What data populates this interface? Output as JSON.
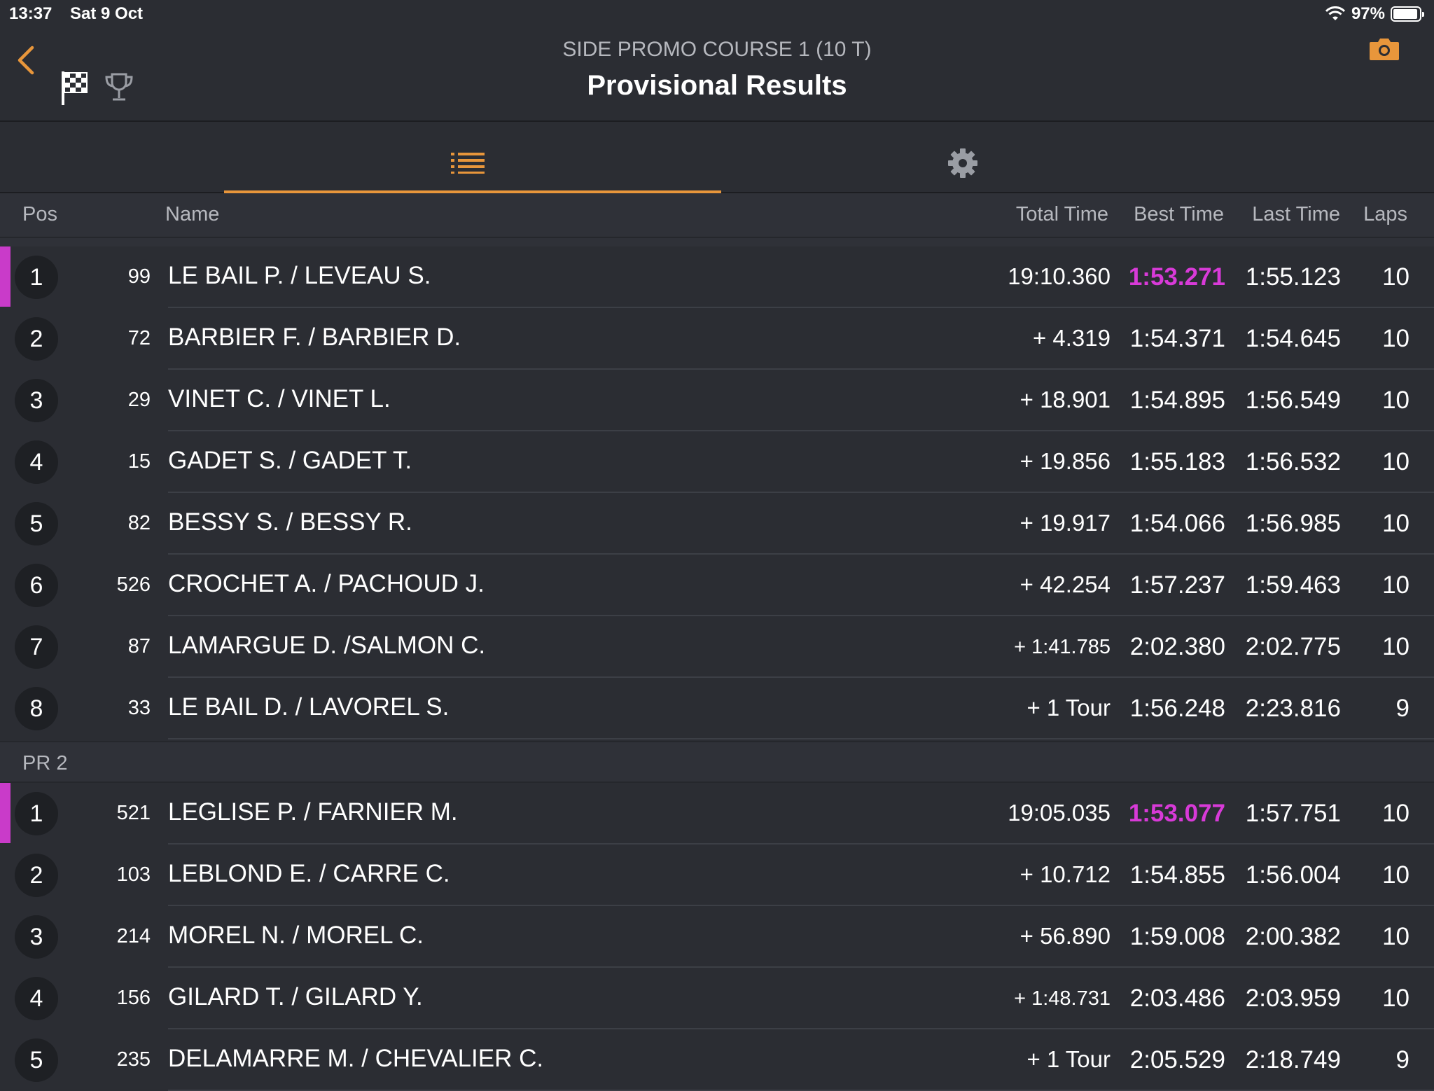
{
  "status": {
    "time": "13:37",
    "date": "Sat 9 Oct",
    "battery": "97%"
  },
  "header": {
    "subtitle": "SIDE PROMO COURSE 1  (10 T)",
    "title": "Provisional Results"
  },
  "columns": {
    "pos": "Pos",
    "name": "Name",
    "total": "Total Time",
    "best": "Best Time",
    "last": "Last Time",
    "laps": "Laps"
  },
  "colors": {
    "accent": "#e8963b",
    "fastest": "#d83ad8",
    "background": "#2b2d33"
  },
  "group1": [
    {
      "pos": "1",
      "num": "99",
      "name": "LE BAIL P. / LEVEAU S.",
      "total": "19:10.360",
      "best": "1:53.271",
      "last": "1:55.123",
      "laps": "10"
    },
    {
      "pos": "2",
      "num": "72",
      "name": "BARBIER F. / BARBIER D.",
      "total": "+ 4.319",
      "best": "1:54.371",
      "last": "1:54.645",
      "laps": "10"
    },
    {
      "pos": "3",
      "num": "29",
      "name": "VINET C. / VINET L.",
      "total": "+ 18.901",
      "best": "1:54.895",
      "last": "1:56.549",
      "laps": "10"
    },
    {
      "pos": "4",
      "num": "15",
      "name": "GADET S. / GADET T.",
      "total": "+ 19.856",
      "best": "1:55.183",
      "last": "1:56.532",
      "laps": "10"
    },
    {
      "pos": "5",
      "num": "82",
      "name": "BESSY S. / BESSY R.",
      "total": "+ 19.917",
      "best": "1:54.066",
      "last": "1:56.985",
      "laps": "10"
    },
    {
      "pos": "6",
      "num": "526",
      "name": "CROCHET A. / PACHOUD J.",
      "total": "+ 42.254",
      "best": "1:57.237",
      "last": "1:59.463",
      "laps": "10"
    },
    {
      "pos": "7",
      "num": "87",
      "name": "LAMARGUE D. /SALMON C.",
      "total": "+ 1:41.785",
      "best": "2:02.380",
      "last": "2:02.775",
      "laps": "10"
    },
    {
      "pos": "8",
      "num": "33",
      "name": "LE BAIL D. / LAVOREL S.",
      "total": "+ 1 Tour",
      "best": "1:56.248",
      "last": "2:23.816",
      "laps": "9"
    }
  ],
  "section2": {
    "label": "PR 2"
  },
  "group2": [
    {
      "pos": "1",
      "num": "521",
      "name": "LEGLISE P. / FARNIER M.",
      "total": "19:05.035",
      "best": "1:53.077",
      "last": "1:57.751",
      "laps": "10"
    },
    {
      "pos": "2",
      "num": "103",
      "name": "LEBLOND E. / CARRE C.",
      "total": "+ 10.712",
      "best": "1:54.855",
      "last": "1:56.004",
      "laps": "10"
    },
    {
      "pos": "3",
      "num": "214",
      "name": "MOREL N. / MOREL C.",
      "total": "+ 56.890",
      "best": "1:59.008",
      "last": "2:00.382",
      "laps": "10"
    },
    {
      "pos": "4",
      "num": "156",
      "name": "GILARD T. / GILARD Y.",
      "total": "+ 1:48.731",
      "best": "2:03.486",
      "last": "2:03.959",
      "laps": "10"
    },
    {
      "pos": "5",
      "num": "235",
      "name": "DELAMARRE M. / CHEVALIER C.",
      "total": "+ 1 Tour",
      "best": "2:05.529",
      "last": "2:18.749",
      "laps": "9"
    }
  ]
}
